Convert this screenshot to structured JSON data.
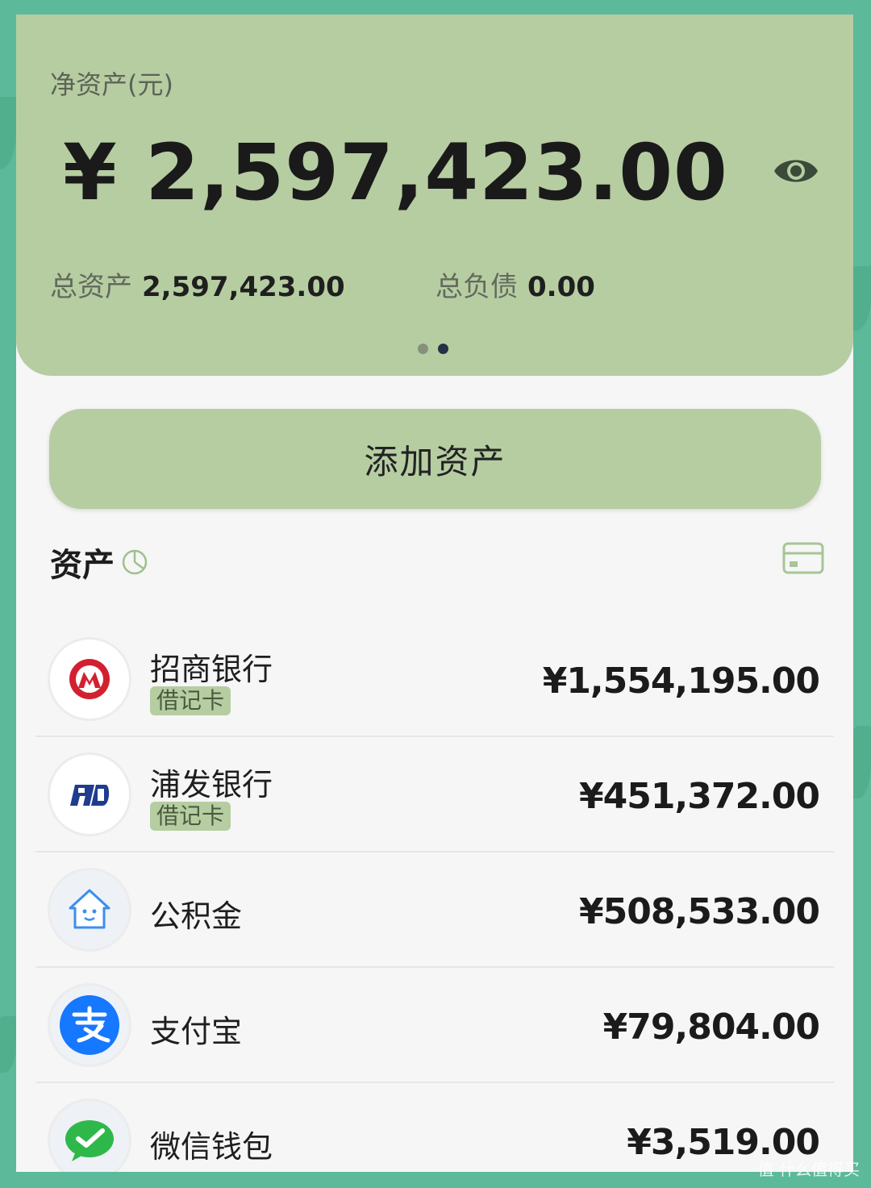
{
  "summary": {
    "net_label": "净资产(元)",
    "net_value": "¥ 2,597,423.00",
    "total_assets_label": "总资产",
    "total_assets_value": "2,597,423.00",
    "total_debt_label": "总负债",
    "total_debt_value": "0.00",
    "page_indicator": {
      "count": 2,
      "active": 2
    }
  },
  "add_button": {
    "label": "添加资产"
  },
  "assets_section": {
    "title": "资产"
  },
  "assets": [
    {
      "name": "招商银行",
      "tag": "借记卡",
      "amount": "¥1,554,195.00",
      "icon": "cmb-bank-icon"
    },
    {
      "name": "浦发银行",
      "tag": "借记卡",
      "amount": "¥451,372.00",
      "icon": "spdb-bank-icon"
    },
    {
      "name": "公积金",
      "tag": "",
      "amount": "¥508,533.00",
      "icon": "housing-fund-icon"
    },
    {
      "name": "支付宝",
      "tag": "",
      "amount": "¥79,804.00",
      "icon": "alipay-icon"
    },
    {
      "name": "微信钱包",
      "tag": "",
      "amount": "¥3,519.00",
      "icon": "wechat-wallet-icon"
    }
  ],
  "watermark": "值 什么值得买",
  "colors": {
    "accent_green": "#b6cda2",
    "frame": "#5cb99a"
  }
}
